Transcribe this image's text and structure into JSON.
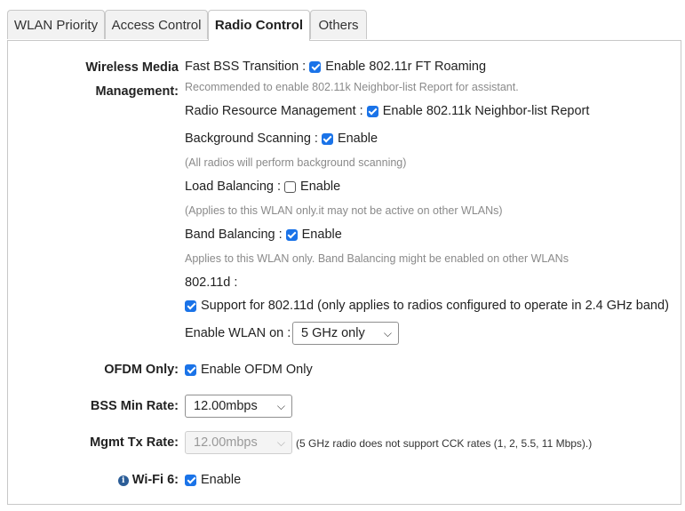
{
  "tabs": [
    "WLAN Priority",
    "Access Control",
    "Radio Control",
    "Others"
  ],
  "wireless_media": {
    "label_line1": "Wireless Media",
    "label_line2": "Management:",
    "fbt_label": "Fast BSS Transition :",
    "fbt_option": "Enable 802.11r FT Roaming",
    "fbt_hint": "Recommended to enable 802.11k Neighbor-list Report for assistant.",
    "rrm_label": "Radio Resource Management :",
    "rrm_option": "Enable 802.11k Neighbor-list Report",
    "bg_label": "Background Scanning :",
    "bg_option": "Enable",
    "bg_hint": "(All radios will perform background scanning)",
    "lb_label": "Load Balancing :",
    "lb_option": "Enable",
    "lb_hint": "(Applies to this WLAN only.it may not be active on other WLANs)",
    "bb_label": "Band Balancing :",
    "bb_option": "Enable",
    "bb_hint": "Applies to this WLAN only. Band Balancing might be enabled on other WLANs",
    "d11_label": "802.11d :",
    "d11_option": "Support for 802.11d (only applies to radios configured to operate in 2.4 GHz band)",
    "wlan_on_label": "Enable WLAN on :",
    "wlan_on_value": "5 GHz only"
  },
  "ofdm": {
    "label": "OFDM Only:",
    "option": "Enable OFDM Only"
  },
  "bss": {
    "label": "BSS Min Rate:",
    "value": "12.00mbps"
  },
  "mgmt": {
    "label": "Mgmt Tx Rate:",
    "value": "12.00mbps",
    "note": "(5 GHz radio does not support CCK rates (1, 2, 5.5, 11 Mbps).)"
  },
  "wifi6": {
    "label": "Wi-Fi 6:",
    "option": "Enable",
    "info_glyph": "i"
  },
  "checkbox_state": {
    "fbt": true,
    "rrm": true,
    "bg": true,
    "lb": false,
    "bb": true,
    "d11": true,
    "ofdm": true,
    "wifi6": true
  },
  "colors": {
    "accent": "#1a73e8",
    "hint": "#8a8a8a",
    "info": "#2b5d97"
  },
  "icons": {
    "dropdown": "chevron-down-icon",
    "info": "info-icon",
    "check": "checkbox-icon"
  }
}
